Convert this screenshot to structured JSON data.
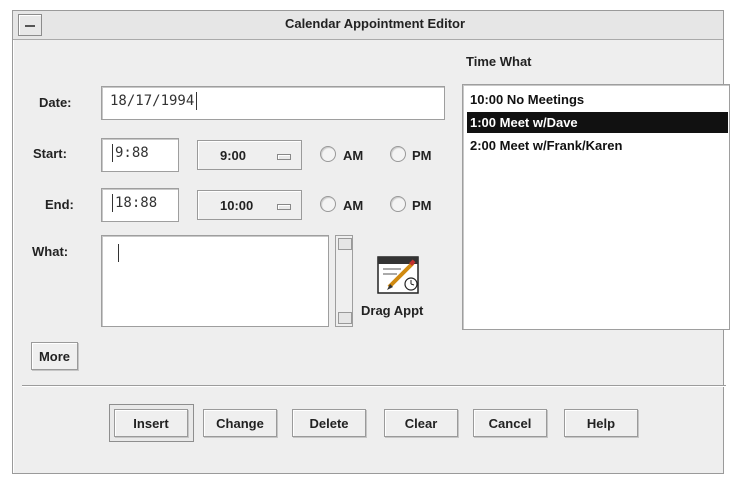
{
  "window": {
    "title": "Calendar Appointment Editor"
  },
  "form": {
    "date_label": "Date:",
    "date_value": "18/17/1994",
    "start_label": "Start:",
    "start_value": "9:88",
    "start_menu": "9:00",
    "end_label": "End:",
    "end_value": "18:88",
    "end_menu": "10:00",
    "am_label": "AM",
    "pm_label": "PM",
    "what_label": "What:",
    "what_value": "",
    "drag_label": "Drag Appt",
    "more_label": "More"
  },
  "list": {
    "header_time": "Time",
    "header_what": "What",
    "items": [
      {
        "text": "10:00 No Meetings",
        "selected": false
      },
      {
        "text": "1:00 Meet w/Dave",
        "selected": true
      },
      {
        "text": "2:00 Meet w/Frank/Karen",
        "selected": false
      }
    ]
  },
  "buttons": {
    "insert": "Insert",
    "change": "Change",
    "delete": "Delete",
    "clear": "Clear",
    "cancel": "Cancel",
    "help": "Help"
  }
}
